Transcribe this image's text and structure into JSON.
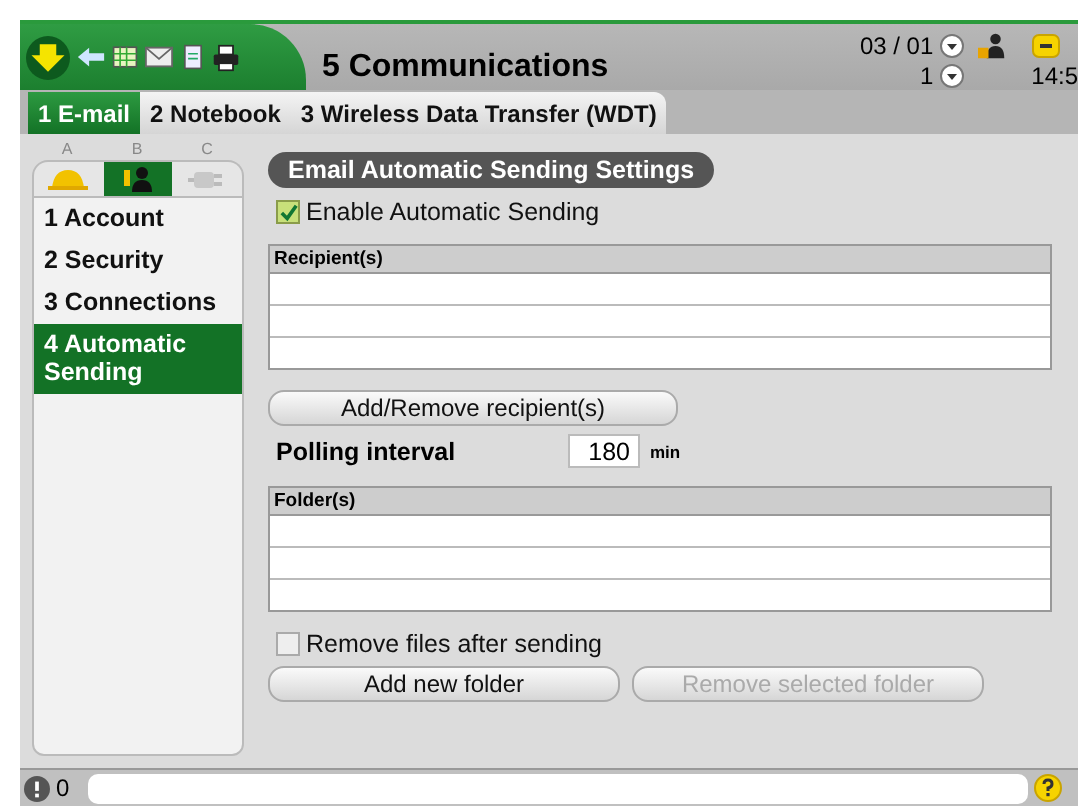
{
  "header": {
    "title": "5 Communications",
    "date": "03 / 01",
    "page": "1",
    "time": "14:5"
  },
  "tabs": [
    {
      "label": "1 E-mail",
      "selected": true
    },
    {
      "label": "2 Notebook",
      "selected": false
    },
    {
      "label": "3 Wireless Data Transfer (WDT)",
      "selected": false
    }
  ],
  "sidebar": {
    "category_tabs": [
      {
        "letter": "A",
        "kind": "helmet",
        "selected": false
      },
      {
        "letter": "B",
        "kind": "person",
        "selected": true
      },
      {
        "letter": "C",
        "kind": "plug",
        "selected": false
      }
    ],
    "items": [
      {
        "label": "1 Account",
        "selected": false
      },
      {
        "label": "2 Security",
        "selected": false
      },
      {
        "label": "3 Connections",
        "selected": false
      },
      {
        "label": "4 Automatic Sending",
        "selected": true
      }
    ]
  },
  "section_title": "Email Automatic Sending Settings",
  "enable_option": {
    "label": "Enable Automatic Sending",
    "checked": true
  },
  "recipients_table": {
    "columns": [
      "Recipient(s)"
    ]
  },
  "recipients_button": "Add/Remove recipient(s)",
  "polling": {
    "label": "Polling interval",
    "value": "180",
    "unit": "min"
  },
  "folders_table": {
    "columns": [
      "Folder(s)"
    ]
  },
  "remove_option": {
    "label": "Remove files after sending",
    "checked": false
  },
  "buttons": [
    {
      "label": "Add new folder",
      "disabled": false
    },
    {
      "label": "Remove selected folder",
      "disabled": true
    }
  ],
  "status_bar": {
    "count": "0"
  }
}
